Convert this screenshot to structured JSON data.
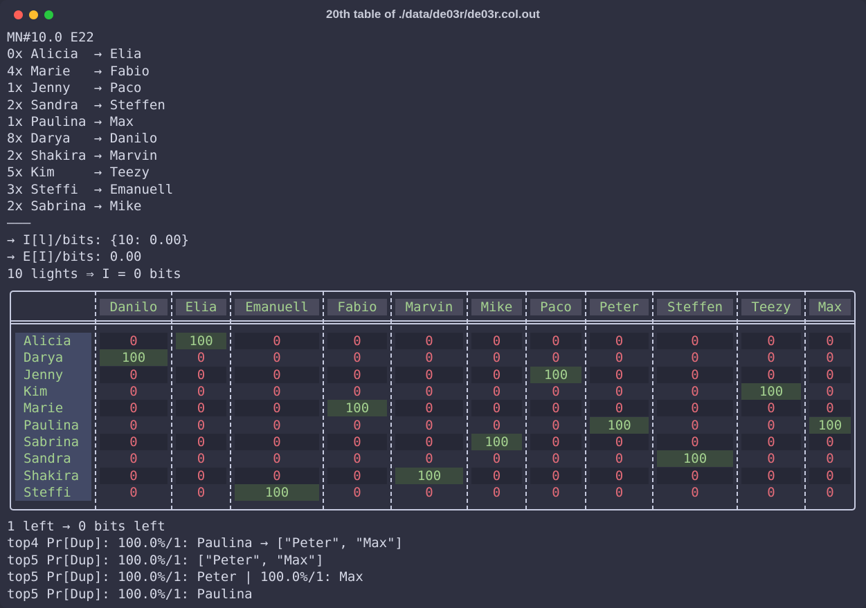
{
  "window": {
    "title": "20th table of ./data/de03r/de03r.col.out"
  },
  "log_lines": [
    "MN#10.0 E22",
    "0x Alicia  → Elia",
    "4x Marie   → Fabio",
    "1x Jenny   → Paco",
    "2x Sandra  → Steffen",
    "1x Paulina → Max",
    "8x Darya   → Danilo",
    "2x Shakira → Marvin",
    "5x Kim     → Teezy",
    "3x Steffi  → Emanuell",
    "2x Sabrina → Mike",
    "———",
    "→ I[l]/bits: {10: 0.00}",
    "→ E[I]/bits: 0.00",
    "10 lights ⇒ I = 0 bits"
  ],
  "table": {
    "columns": [
      "Danilo",
      "Elia",
      "Emanuell",
      "Fabio",
      "Marvin",
      "Mike",
      "Paco",
      "Peter",
      "Steffen",
      "Teezy",
      "Max"
    ],
    "rows": [
      {
        "name": "Alicia",
        "values": [
          "0",
          "100",
          "0",
          "0",
          "0",
          "0",
          "0",
          "0",
          "0",
          "0",
          "0"
        ]
      },
      {
        "name": "Darya",
        "values": [
          "100",
          "0",
          "0",
          "0",
          "0",
          "0",
          "0",
          "0",
          "0",
          "0",
          "0"
        ]
      },
      {
        "name": "Jenny",
        "values": [
          "0",
          "0",
          "0",
          "0",
          "0",
          "0",
          "100",
          "0",
          "0",
          "0",
          "0"
        ]
      },
      {
        "name": "Kim",
        "values": [
          "0",
          "0",
          "0",
          "0",
          "0",
          "0",
          "0",
          "0",
          "0",
          "100",
          "0"
        ]
      },
      {
        "name": "Marie",
        "values": [
          "0",
          "0",
          "0",
          "100",
          "0",
          "0",
          "0",
          "0",
          "0",
          "0",
          "0"
        ]
      },
      {
        "name": "Paulina",
        "values": [
          "0",
          "0",
          "0",
          "0",
          "0",
          "0",
          "0",
          "100",
          "0",
          "0",
          "100"
        ]
      },
      {
        "name": "Sabrina",
        "values": [
          "0",
          "0",
          "0",
          "0",
          "0",
          "100",
          "0",
          "0",
          "0",
          "0",
          "0"
        ]
      },
      {
        "name": "Sandra",
        "values": [
          "0",
          "0",
          "0",
          "0",
          "0",
          "0",
          "0",
          "0",
          "100",
          "0",
          "0"
        ]
      },
      {
        "name": "Shakira",
        "values": [
          "0",
          "0",
          "0",
          "0",
          "100",
          "0",
          "0",
          "0",
          "0",
          "0",
          "0"
        ]
      },
      {
        "name": "Steffi",
        "values": [
          "0",
          "0",
          "100",
          "0",
          "0",
          "0",
          "0",
          "0",
          "0",
          "0",
          "0"
        ]
      }
    ]
  },
  "footer_lines": [
    "1 left → 0 bits left",
    "top4 Pr[Dup]: 100.0%/1: Paulina → [\"Peter\", \"Max\"]",
    "top5 Pr[Dup]: 100.0%/1: [\"Peter\", \"Max\"]",
    "top5 Pr[Dup]: 100.0%/1: Peter | 100.0%/1: Max",
    "top5 Pr[Dup]: 100.0%/1: Paulina"
  ]
}
